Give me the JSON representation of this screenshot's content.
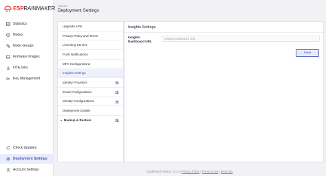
{
  "app": {
    "logo_esp": "ESP",
    "logo_rainmaker": "RAINMAKER",
    "brand_color": "#e53935",
    "accent_color": "#3f51b5"
  },
  "sidebar": {
    "items": [
      {
        "label": "Statistics",
        "icon": "statistics-icon"
      },
      {
        "label": "Nodes",
        "icon": "nodes-icon"
      },
      {
        "label": "Node Groups",
        "icon": "node-groups-icon"
      },
      {
        "label": "Firmware Images",
        "icon": "firmware-images-icon"
      },
      {
        "label": "OTA Jobs",
        "icon": "ota-jobs-icon"
      },
      {
        "label": "Key Management",
        "icon": "key-management-icon"
      }
    ],
    "bottom_items": [
      {
        "label": "Check Updates",
        "icon": "check-updates-icon"
      },
      {
        "label": "Deployment Settings",
        "icon": "deployment-settings-icon",
        "active": true
      },
      {
        "label": "Account Settings",
        "icon": "account-settings-icon"
      }
    ]
  },
  "header": {
    "breadcrumb": "Options",
    "title": "Deployment Settings"
  },
  "settings_menu": {
    "items": [
      {
        "label": "Upgrade APIs"
      },
      {
        "label": "Privacy Policy and Terms"
      },
      {
        "label": "Licensing Service"
      },
      {
        "label": "Push Notifications"
      },
      {
        "label": "MFA Configurations"
      },
      {
        "label": "Insights Settings",
        "active": true
      },
      {
        "label": "Identity Providers",
        "badge": "admin-badge-icon"
      },
      {
        "label": "Email Configurations",
        "badge": "admin-badge-icon"
      },
      {
        "label": "Identity Configurations",
        "badge": "admin-badge-icon"
      },
      {
        "label": "Deployment Details"
      },
      {
        "label": "Backup & Restore",
        "badge": "admin-badge-icon",
        "group": true
      }
    ]
  },
  "insights": {
    "section_title": "Insights Settings",
    "field_label": "Insights Dashboard URL",
    "field_value": "",
    "field_placeholder": "Insights Dashboard URL",
    "save_label": "Save"
  },
  "footer": {
    "version_text": "Dashboard Version: 2.1.0",
    "separator": "|",
    "privacy_label": "Privacy Policy",
    "terms_label": "Terms of use",
    "more_info_label": "More Info"
  }
}
